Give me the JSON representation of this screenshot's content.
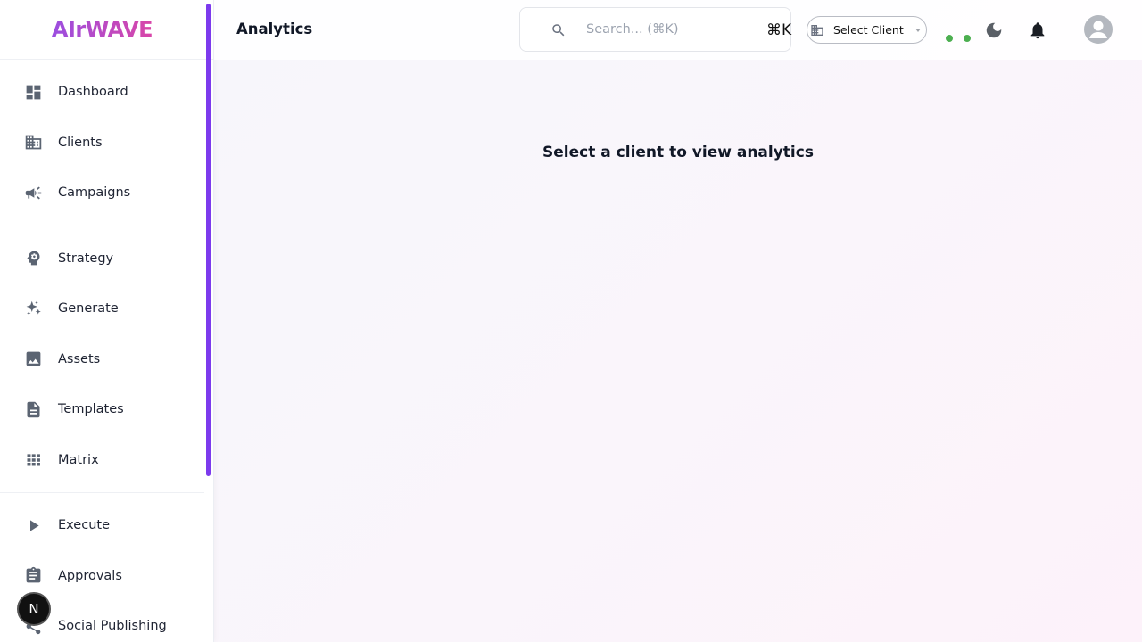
{
  "brand": {
    "name": "AIrWAVE"
  },
  "sidebar": {
    "groups": [
      {
        "items": [
          {
            "label": "Dashboard",
            "icon": "dashboard-icon"
          },
          {
            "label": "Clients",
            "icon": "building-icon"
          },
          {
            "label": "Campaigns",
            "icon": "megaphone-icon"
          }
        ]
      },
      {
        "items": [
          {
            "label": "Strategy",
            "icon": "brain-icon"
          },
          {
            "label": "Generate",
            "icon": "sparkles-icon"
          },
          {
            "label": "Assets",
            "icon": "image-icon"
          },
          {
            "label": "Templates",
            "icon": "document-icon"
          },
          {
            "label": "Matrix",
            "icon": "grid-icon"
          }
        ]
      },
      {
        "items": [
          {
            "label": "Execute",
            "icon": "play-icon"
          },
          {
            "label": "Approvals",
            "icon": "clipboard-icon"
          },
          {
            "label": "Social Publishing",
            "icon": "share-icon"
          }
        ]
      }
    ]
  },
  "badge": {
    "letter": "N"
  },
  "header": {
    "title": "Analytics",
    "search": {
      "placeholder": "Search... (⌘K)",
      "shortcut": "⌘K"
    },
    "client_select": {
      "label": "Select Client"
    },
    "status_dots": [
      "#4caf50",
      "#4caf50"
    ]
  },
  "main": {
    "empty_message": "Select a client to view analytics"
  },
  "colors": {
    "accent": "#7c3aed",
    "brand_start": "#9b4ee0",
    "brand_end": "#d946a8"
  }
}
